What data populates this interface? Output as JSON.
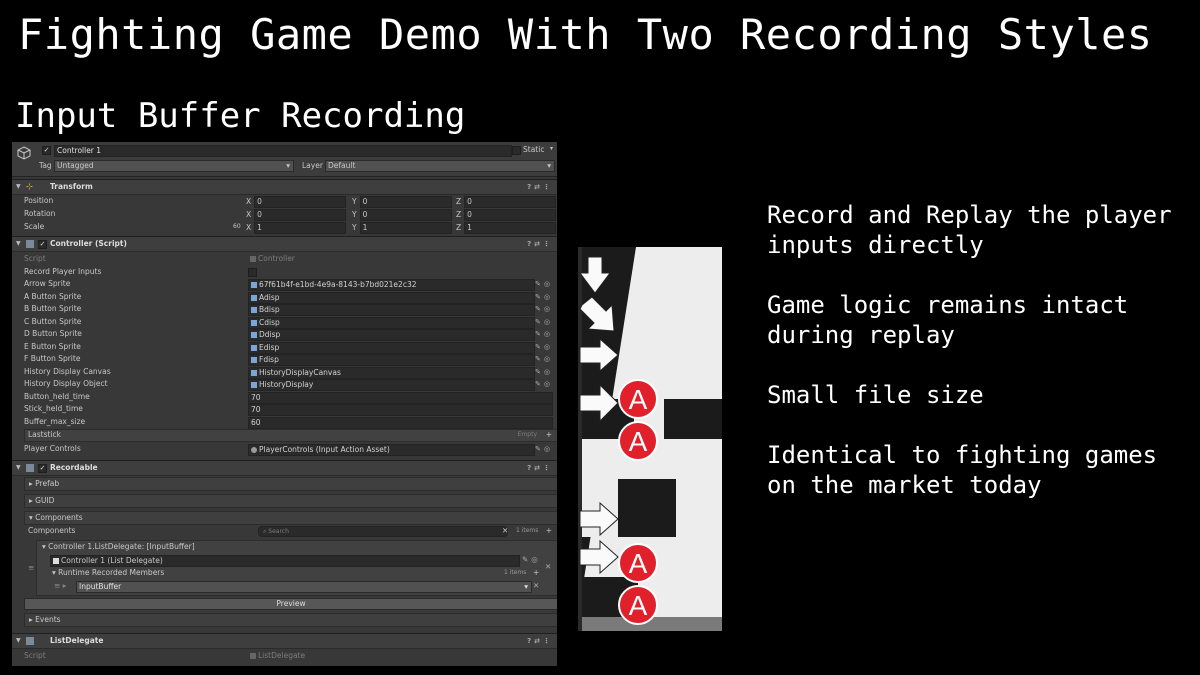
{
  "slide": {
    "title": "Fighting Game Demo With Two Recording Styles",
    "subtitle": "Input Buffer Recording",
    "bullets": [
      "Record and Replay the player inputs directly",
      "Game logic remains intact during replay",
      "Small file size",
      "Identical to fighting games on the market today"
    ]
  },
  "inspector": {
    "object_name": "Controller 1",
    "static_label": "Static",
    "tag_label": "Tag",
    "tag_value": "Untagged",
    "layer_label": "Layer",
    "layer_value": "Default",
    "transform": {
      "title": "Transform",
      "position_label": "Position",
      "rotation_label": "Rotation",
      "scale_label": "Scale",
      "scale_lock": "60",
      "position": [
        "0",
        "0",
        "0"
      ],
      "rotation": [
        "0",
        "0",
        "0"
      ],
      "scale": [
        "1",
        "1",
        "1"
      ],
      "axis": [
        "X",
        "Y",
        "Z"
      ]
    },
    "controller_script": {
      "title": "Controller (Script)",
      "script_label": "Script",
      "script_value": "Controller",
      "record_label": "Record Player Inputs",
      "fields": [
        {
          "label": "Arrow Sprite",
          "value": "67f61b4f-e1bd-4e9a-8143-b7bd021e2c32"
        },
        {
          "label": "A Button Sprite",
          "value": "Adisp"
        },
        {
          "label": "B Button Sprite",
          "value": "Bdisp"
        },
        {
          "label": "C Button Sprite",
          "value": "Cdisp"
        },
        {
          "label": "D Button Sprite",
          "value": "Ddisp"
        },
        {
          "label": "E Button Sprite",
          "value": "Edisp"
        },
        {
          "label": "F Button Sprite",
          "value": "Fdisp"
        },
        {
          "label": "History Display Canvas",
          "value": "HistoryDisplayCanvas"
        },
        {
          "label": "History Display Object",
          "value": "HistoryDisplay"
        }
      ],
      "numbers": [
        {
          "label": "Button_held_time",
          "value": "70"
        },
        {
          "label": "Stick_held_time",
          "value": "70"
        },
        {
          "label": "Buffer_max_size",
          "value": "60"
        }
      ],
      "laststick_label": "Laststick",
      "laststick_empty": "Empty",
      "player_controls_label": "Player Controls",
      "player_controls_value": "PlayerControls (Input Action Asset)"
    },
    "recordable": {
      "title": "Recordable",
      "prefab": "Prefab",
      "guid": "GUID",
      "components": "Components",
      "components_list_label": "Components",
      "search_placeholder": "Search",
      "items_count": "1 items",
      "delegate_title": "Controller 1.ListDelegate: [InputBuffer]",
      "delegate_ref": "Controller 1 (List Delegate)",
      "runtime_members": "Runtime Recorded Members",
      "runtime_count": "1 items",
      "member": "InputBuffer",
      "preview": "Preview",
      "events": "Events"
    },
    "list_delegate": {
      "title": "ListDelegate",
      "script_label": "Script",
      "script_value": "ListDelegate"
    }
  },
  "game_panel": {
    "button_letter": "A",
    "colors": {
      "button_red": "#e0202a",
      "board_dark": "#1b1b1b",
      "board_light": "#ededed"
    }
  }
}
